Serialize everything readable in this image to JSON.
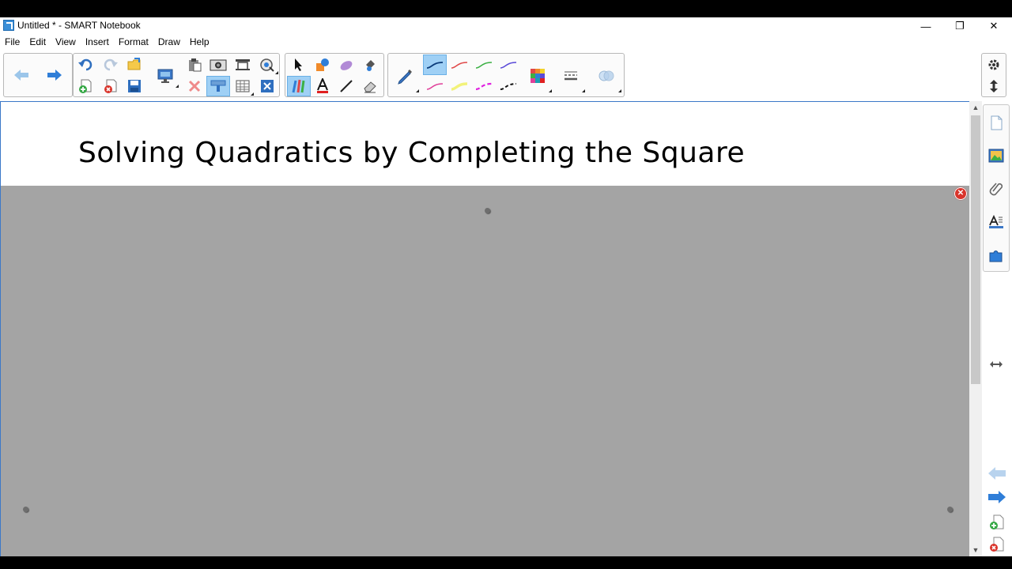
{
  "window": {
    "title": "Untitled * - SMART Notebook",
    "controls": {
      "minimize": "—",
      "restore": "❐",
      "close": "✕"
    }
  },
  "menu": [
    "File",
    "Edit",
    "View",
    "Insert",
    "Format",
    "Draw",
    "Help"
  ],
  "toolbar": {
    "groups": [
      {
        "name": "navigation",
        "icons": [
          "previous-page-icon",
          "next-page-icon"
        ]
      },
      {
        "name": "document",
        "icons": [
          "undo-icon",
          "redo-icon",
          "open-file-icon",
          "add-page-icon",
          "delete-page-icon",
          "save-icon",
          "display-screens-icon",
          "paste-icon",
          "insert-image-icon",
          "capture-icon",
          "document-camera-icon",
          "delete-icon",
          "screen-shade-icon",
          "table-icon",
          "full-screen-icon"
        ]
      },
      {
        "name": "tools",
        "icons": [
          "select-icon",
          "shapes-icon",
          "eraser-icon",
          "fill-icon",
          "pens-icon",
          "text-icon",
          "lines-icon",
          "magic-eraser-icon"
        ]
      },
      {
        "name": "pen-styles",
        "icons": [
          "pen-tool-icon",
          "pen-style-icon",
          "color-palette-icon",
          "line-properties-icon",
          "transparency-icon"
        ]
      }
    ],
    "right": [
      "settings-icon",
      "move-toolbar-icon"
    ],
    "colors": {
      "active": "#9fd0f5",
      "blue": "#2f7ed8",
      "red": "#e04848",
      "green": "#3cb044",
      "purple": "#5a4ad8",
      "pink": "#e0409a",
      "yellow": "#f2f27a",
      "magenta": "#e020e0",
      "black": "#111111"
    }
  },
  "page": {
    "title": "Solving Quadratics by Completing the Square",
    "shade_color": "#a4a4a4"
  },
  "sidebar": {
    "tabs": [
      "page-sorter-icon",
      "gallery-icon",
      "attachments-icon",
      "properties-icon",
      "add-ons-icon"
    ],
    "resize_icon": "resize-icon",
    "bottom": [
      "previous-page-icon",
      "next-page-icon",
      "add-page-icon",
      "delete-page-icon"
    ]
  }
}
